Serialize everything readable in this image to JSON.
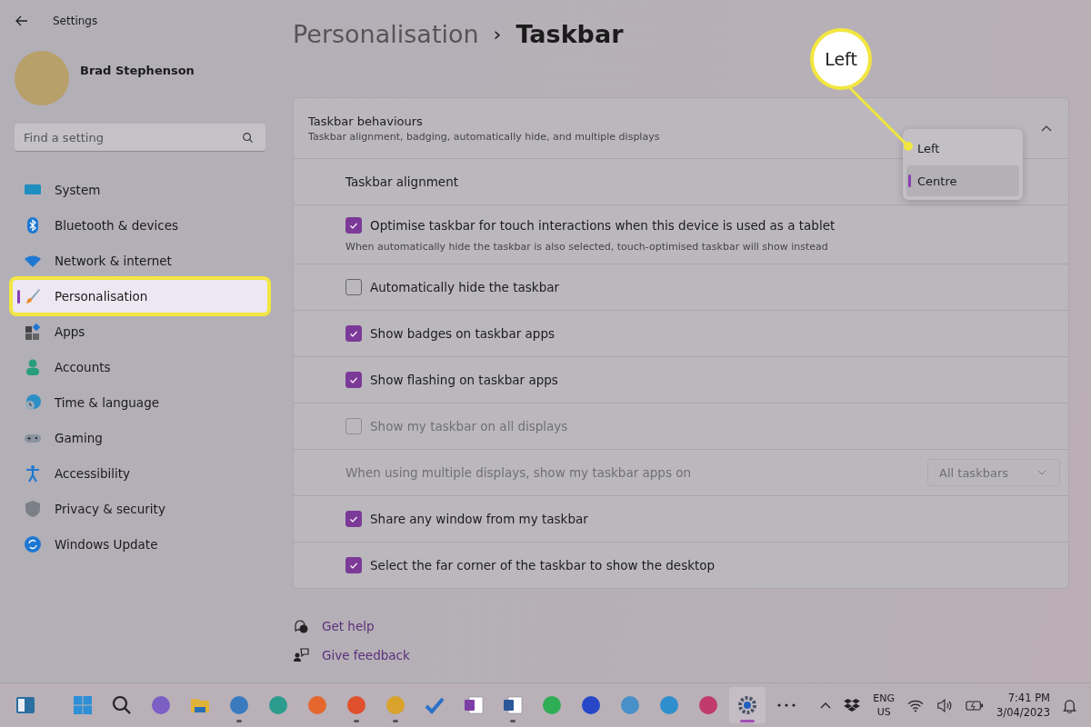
{
  "window": {
    "title": "Settings"
  },
  "user": {
    "name": "Brad Stephenson"
  },
  "search": {
    "placeholder": "Find a setting"
  },
  "nav": [
    {
      "label": "System",
      "selected": false,
      "highlighted": false
    },
    {
      "label": "Bluetooth & devices",
      "selected": false,
      "highlighted": false
    },
    {
      "label": "Network & internet",
      "selected": false,
      "highlighted": false
    },
    {
      "label": "Personalisation",
      "selected": true,
      "highlighted": true
    },
    {
      "label": "Apps",
      "selected": false,
      "highlighted": false
    },
    {
      "label": "Accounts",
      "selected": false,
      "highlighted": false
    },
    {
      "label": "Time & language",
      "selected": false,
      "highlighted": false
    },
    {
      "label": "Gaming",
      "selected": false,
      "highlighted": false
    },
    {
      "label": "Accessibility",
      "selected": false,
      "highlighted": false
    },
    {
      "label": "Privacy & security",
      "selected": false,
      "highlighted": false
    },
    {
      "label": "Windows Update",
      "selected": false,
      "highlighted": false
    }
  ],
  "breadcrumb": {
    "parent": "Personalisation",
    "separator": "›",
    "current": "Taskbar"
  },
  "section": {
    "title": "Taskbar behaviours",
    "subtitle": "Taskbar alignment, badging, automatically hide, and multiple displays",
    "expanded": true,
    "rows": [
      {
        "kind": "dropdown",
        "label": "Taskbar alignment",
        "disabled": false
      },
      {
        "kind": "checkbox",
        "label": "Optimise taskbar for touch interactions when this device is used as a tablet",
        "description": "When automatically hide the taskbar is also selected, touch-optimised taskbar will show instead",
        "checked": true,
        "disabled": false
      },
      {
        "kind": "checkbox",
        "label": "Automatically hide the taskbar",
        "checked": false,
        "disabled": false
      },
      {
        "kind": "checkbox",
        "label": "Show badges on taskbar apps",
        "checked": true,
        "disabled": false
      },
      {
        "kind": "checkbox",
        "label": "Show flashing on taskbar apps",
        "checked": true,
        "disabled": false
      },
      {
        "kind": "checkbox",
        "label": "Show my taskbar on all displays",
        "checked": false,
        "disabled": true
      },
      {
        "kind": "select",
        "label": "When using multiple displays, show my taskbar apps on",
        "value": "All taskbars",
        "disabled": true
      },
      {
        "kind": "checkbox",
        "label": "Share any window from my taskbar",
        "checked": true,
        "disabled": false
      },
      {
        "kind": "checkbox",
        "label": "Select the far corner of the taskbar to show the desktop",
        "checked": true,
        "disabled": false
      }
    ]
  },
  "alignment_menu": [
    {
      "label": "Left",
      "selected": false
    },
    {
      "label": "Centre",
      "selected": true
    }
  ],
  "callout": {
    "label": "Left"
  },
  "links": [
    "Get help",
    "Give feedback"
  ],
  "taskbar": {
    "apps": [
      {
        "running": false,
        "selected": false
      },
      {
        "running": false,
        "selected": false
      },
      {
        "running": false,
        "selected": false
      },
      {
        "running": false,
        "selected": false
      },
      {
        "running": false,
        "selected": false
      },
      {
        "running": true,
        "selected": false
      },
      {
        "running": false,
        "selected": false
      },
      {
        "running": false,
        "selected": false
      },
      {
        "running": true,
        "selected": false
      },
      {
        "running": true,
        "selected": false
      },
      {
        "running": false,
        "selected": false
      },
      {
        "running": false,
        "selected": false
      },
      {
        "running": true,
        "selected": false
      },
      {
        "running": false,
        "selected": false
      },
      {
        "running": false,
        "selected": false
      },
      {
        "running": false,
        "selected": false
      },
      {
        "running": false,
        "selected": false
      },
      {
        "running": false,
        "selected": false
      },
      {
        "running": true,
        "selected": true
      },
      {
        "running": false,
        "selected": false
      }
    ],
    "language": [
      "ENG",
      "US"
    ],
    "time": "7:41 PM",
    "date": "3/04/2023"
  }
}
